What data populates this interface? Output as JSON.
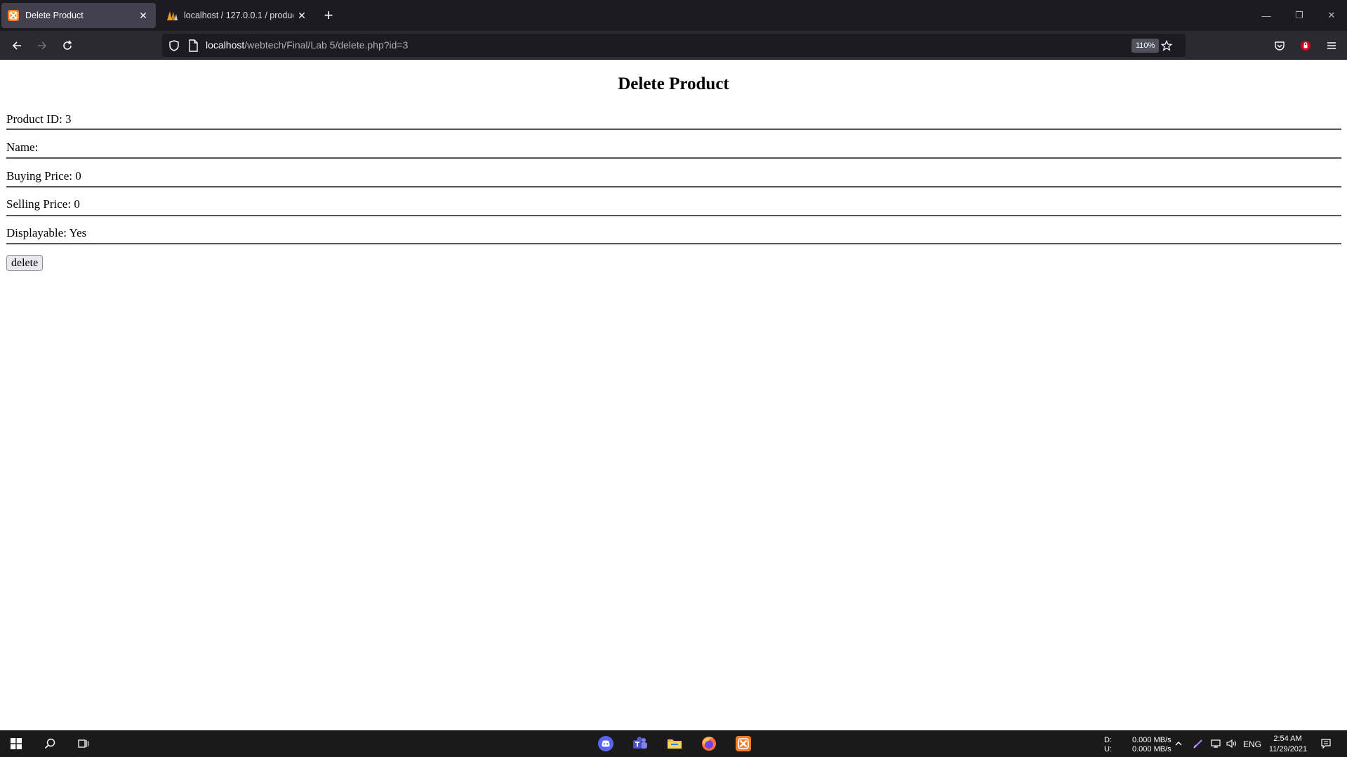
{
  "browser": {
    "tabs": [
      {
        "title": "Delete Product",
        "active": true
      },
      {
        "title": "localhost / 127.0.0.1 / product |",
        "active": false
      }
    ],
    "url_host": "localhost",
    "url_path": "/webtech/Final/Lab 5/delete.php?id=3",
    "zoom": "110%"
  },
  "page": {
    "heading": "Delete Product",
    "fields": [
      {
        "label": "Product ID: 3"
      },
      {
        "label": "Name:"
      },
      {
        "label": "Buying Price: 0"
      },
      {
        "label": "Selling Price: 0"
      },
      {
        "label": "Displayable: Yes"
      }
    ],
    "delete_label": "delete"
  },
  "taskbar": {
    "net_d_label": "D:",
    "net_u_label": "U:",
    "net_down": "0.000 MB/s",
    "net_up": "0.000 MB/s",
    "language": "ENG",
    "time": "2:54 AM",
    "date": "11/29/2021",
    "apps": [
      "discord-icon",
      "teams-icon",
      "file-explorer-icon",
      "firefox-icon",
      "xampp-icon"
    ]
  },
  "colors": {
    "xampp": "#fb7a24",
    "firefox": "#ff7139",
    "discord": "#5865f2",
    "teams": "#5059c9",
    "folder": "#f5c04a"
  }
}
